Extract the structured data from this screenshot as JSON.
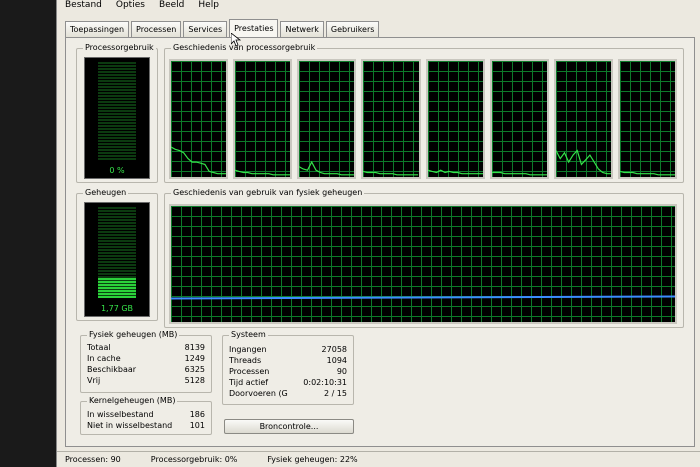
{
  "menu": [
    "Bestand",
    "Opties",
    "Beeld",
    "Help"
  ],
  "tabs": [
    "Toepassingen",
    "Processen",
    "Services",
    "Prestaties",
    "Netwerk",
    "Gebruikers"
  ],
  "active_tab": "Prestaties",
  "cpu": {
    "title": "Processorgebruik",
    "value_label": "0 %",
    "level": 0.0,
    "history_title": "Geschiedenis van processorgebruik",
    "core_count": 8
  },
  "memory": {
    "title": "Geheugen",
    "value_label": "1,77 GB",
    "level": 0.22,
    "history_title": "Geschiedenis van gebruik van fysiek geheugen"
  },
  "physical_memory": {
    "title": "Fysiek geheugen (MB)",
    "rows": [
      {
        "label": "Totaal",
        "value": "8139"
      },
      {
        "label": "In cache",
        "value": "1249"
      },
      {
        "label": "Beschikbaar",
        "value": "6325"
      },
      {
        "label": "Vrij",
        "value": "5128"
      }
    ]
  },
  "kernel_memory": {
    "title": "Kernelgeheugen (MB)",
    "rows": [
      {
        "label": "In wisselbestand",
        "value": "186"
      },
      {
        "label": "Niet in wisselbestand",
        "value": "101"
      }
    ]
  },
  "system": {
    "title": "Systeem",
    "rows": [
      {
        "label": "Ingangen",
        "value": "27058"
      },
      {
        "label": "Threads",
        "value": "1094"
      },
      {
        "label": "Processen",
        "value": "90"
      },
      {
        "label": "Tijd actief",
        "value": "0:02:10:31"
      },
      {
        "label": "Doorvoeren (G",
        "value": "2 / 15"
      }
    ]
  },
  "resource_button": "Broncontrole...",
  "status": {
    "processes": "Processen: 90",
    "cpu": "Processorgebruik: 0%",
    "memory": "Fysiek geheugen: 22%"
  },
  "colors": {
    "graph_line": "#35e24a",
    "memory_line": "#3c8cff",
    "meter_fill": "#2bd13a"
  }
}
